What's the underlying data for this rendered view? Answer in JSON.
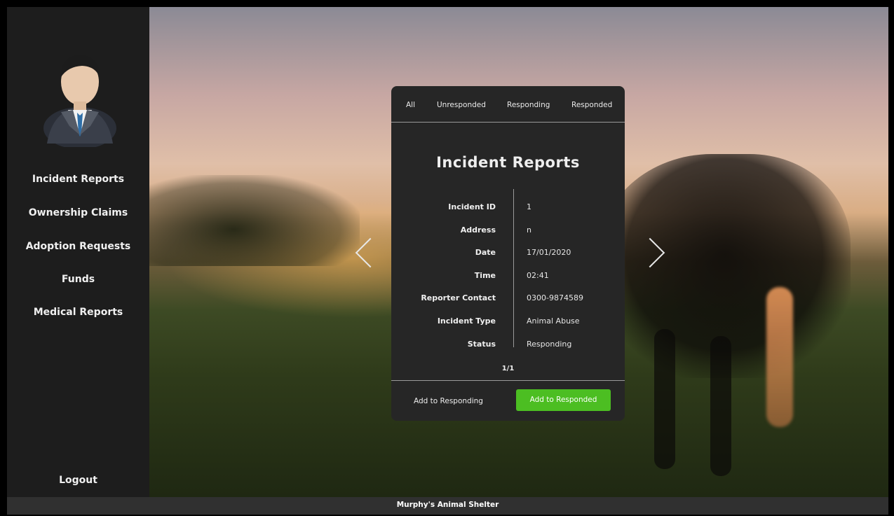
{
  "sidebar": {
    "avatar_alt": "user avatar",
    "items": [
      {
        "label": "Incident Reports"
      },
      {
        "label": "Ownership Claims"
      },
      {
        "label": "Adoption Requests"
      },
      {
        "label": "Funds"
      },
      {
        "label": "Medical Reports"
      }
    ],
    "logout_label": "Logout"
  },
  "tabs": [
    {
      "label": "All"
    },
    {
      "label": "Unresponded"
    },
    {
      "label": "Responding"
    },
    {
      "label": "Responded"
    }
  ],
  "card": {
    "title": "Incident Reports",
    "rows": [
      {
        "label": "Incident ID",
        "value": "1"
      },
      {
        "label": "Address",
        "value": "n"
      },
      {
        "label": "Date",
        "value": "17/01/2020"
      },
      {
        "label": "Time",
        "value": "02:41"
      },
      {
        "label": "Reporter Contact",
        "value": "0300-9874589"
      },
      {
        "label": "Incident Type",
        "value": "Animal Abuse"
      },
      {
        "label": "Status",
        "value": "Responding"
      }
    ],
    "pager": "1/1",
    "secondary_action": "Add to Responding",
    "primary_action": "Add to Responded",
    "primary_color": "#4cbe22"
  },
  "footer": {
    "title": "Murphy's Animal Shelter"
  }
}
